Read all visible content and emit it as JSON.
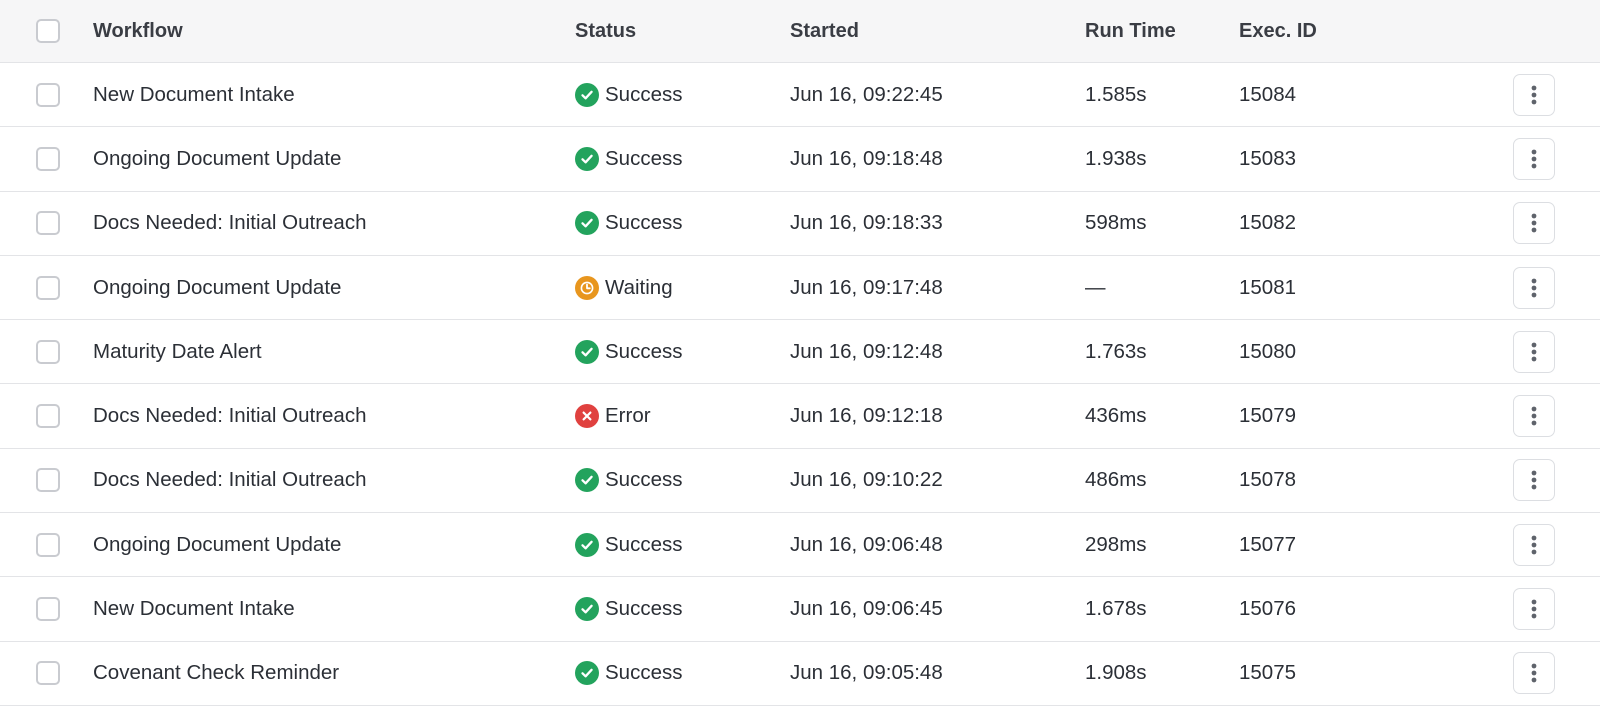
{
  "colors": {
    "success": "#23a35d",
    "waiting": "#e8961e",
    "error": "#e0413f"
  },
  "header": {
    "workflow": "Workflow",
    "status": "Status",
    "started": "Started",
    "run_time": "Run Time",
    "exec_id": "Exec. ID"
  },
  "rows": [
    {
      "workflow": "New Document Intake",
      "status": "Success",
      "status_icon": "check-circle-icon",
      "started": "Jun 16, 09:22:45",
      "run_time": "1.585s",
      "exec_id": "15084"
    },
    {
      "workflow": "Ongoing Document Update",
      "status": "Success",
      "status_icon": "check-circle-icon",
      "started": "Jun 16, 09:18:48",
      "run_time": "1.938s",
      "exec_id": "15083"
    },
    {
      "workflow": "Docs Needed: Initial Outreach",
      "status": "Success",
      "status_icon": "check-circle-icon",
      "started": "Jun 16, 09:18:33",
      "run_time": "598ms",
      "exec_id": "15082"
    },
    {
      "workflow": "Ongoing Document Update",
      "status": "Waiting",
      "status_icon": "clock-icon",
      "started": "Jun 16, 09:17:48",
      "run_time": "—",
      "exec_id": "15081"
    },
    {
      "workflow": "Maturity Date Alert",
      "status": "Success",
      "status_icon": "check-circle-icon",
      "started": "Jun 16, 09:12:48",
      "run_time": "1.763s",
      "exec_id": "15080"
    },
    {
      "workflow": "Docs Needed: Initial Outreach",
      "status": "Error",
      "status_icon": "x-circle-icon",
      "started": "Jun 16, 09:12:18",
      "run_time": "436ms",
      "exec_id": "15079"
    },
    {
      "workflow": "Docs Needed: Initial Outreach",
      "status": "Success",
      "status_icon": "check-circle-icon",
      "started": "Jun 16, 09:10:22",
      "run_time": "486ms",
      "exec_id": "15078"
    },
    {
      "workflow": "Ongoing Document Update",
      "status": "Success",
      "status_icon": "check-circle-icon",
      "started": "Jun 16, 09:06:48",
      "run_time": "298ms",
      "exec_id": "15077"
    },
    {
      "workflow": "New Document Intake",
      "status": "Success",
      "status_icon": "check-circle-icon",
      "started": "Jun 16, 09:06:45",
      "run_time": "1.678s",
      "exec_id": "15076"
    },
    {
      "workflow": "Covenant Check Reminder",
      "status": "Success",
      "status_icon": "check-circle-icon",
      "started": "Jun 16, 09:05:48",
      "run_time": "1.908s",
      "exec_id": "15075"
    }
  ],
  "row_actions_icon": "more-vertical-icon"
}
